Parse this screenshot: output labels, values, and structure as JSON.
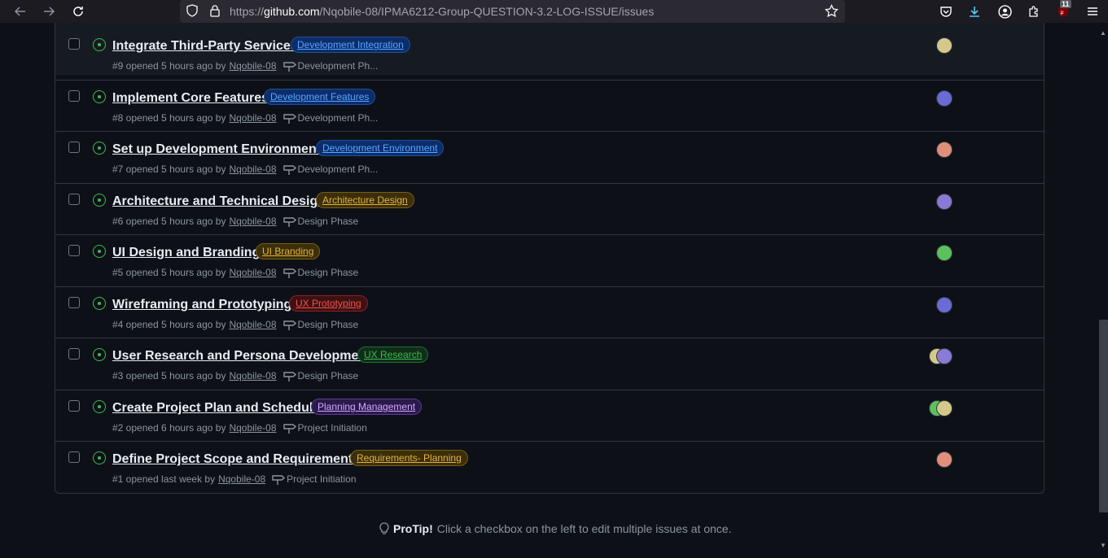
{
  "browser": {
    "url_prefix": "https://",
    "url_host": "github.com",
    "url_path": "/Nqobile-08/IPMA6212-Group-QUESTION-3.2-LOG-ISSUE/issues",
    "extension_badge": "11"
  },
  "issues": [
    {
      "title": "Integrate Third-Party Services",
      "label": "Development Integration",
      "label_color": "#58a6ff",
      "label_bg": "#0c2d6b",
      "meta": "#9 opened 5 hours ago by",
      "author": "Nqobile-08",
      "milestone": "Development Ph...",
      "avatar_colors": [
        "#d4c98a"
      ]
    },
    {
      "title": "Implement Core Features",
      "label": "Development Features",
      "label_color": "#58a6ff",
      "label_bg": "#0c2d6b",
      "meta": "#8 opened 5 hours ago by",
      "author": "Nqobile-08",
      "milestone": "Development Ph...",
      "avatar_colors": [
        "#6a6bd6"
      ]
    },
    {
      "title": "Set up Development Environment",
      "label": "Development Environment",
      "label_color": "#58a6ff",
      "label_bg": "#0c2d6b",
      "meta": "#7 opened 5 hours ago by",
      "author": "Nqobile-08",
      "milestone": "Development Ph...",
      "avatar_colors": [
        "#e0907a"
      ]
    },
    {
      "title": "Architecture and Technical Design",
      "label": "Architecture Design",
      "label_color": "#e3b341",
      "label_bg": "#3b2e0a",
      "meta": "#6 opened 5 hours ago by",
      "author": "Nqobile-08",
      "milestone": "Design Phase",
      "avatar_colors": [
        "#8a7ad6"
      ]
    },
    {
      "title": "UI Design and Branding",
      "label": "UI Branding",
      "label_color": "#e3b341",
      "label_bg": "#3b2e0a",
      "meta": "#5 opened 5 hours ago by",
      "author": "Nqobile-08",
      "milestone": "Design Phase",
      "avatar_colors": [
        "#5cc15c"
      ]
    },
    {
      "title": "Wireframing and Prototyping",
      "label": "UX Prototyping",
      "label_color": "#f85149",
      "label_bg": "#3d1114",
      "meta": "#4 opened 5 hours ago by",
      "author": "Nqobile-08",
      "milestone": "Design Phase",
      "avatar_colors": [
        "#6a6bd6"
      ]
    },
    {
      "title": "User Research and Persona Development",
      "label": "UX Research",
      "label_color": "#3fb950",
      "label_bg": "#0f2e18",
      "meta": "#3 opened 5 hours ago by",
      "author": "Nqobile-08",
      "milestone": "Design Phase",
      "avatar_colors": [
        "#d4c98a",
        "#8a7ad6"
      ]
    },
    {
      "title": "Create Project Plan and Schedule",
      "label": "Planning Management",
      "label_color": "#d2a8ff",
      "label_bg": "#2a1a4a",
      "meta": "#2 opened 6 hours ago by",
      "author": "Nqobile-08",
      "milestone": "Project Initiation",
      "avatar_colors": [
        "#5cc15c",
        "#d4c98a"
      ]
    },
    {
      "title": "Define Project Scope and Requirements",
      "label": "Requirements- Planning",
      "label_color": "#e3b341",
      "label_bg": "#3b2e0a",
      "meta": "#1 opened last week by",
      "author": "Nqobile-08",
      "milestone": "Project Initiation",
      "avatar_colors": [
        "#e0907a"
      ]
    }
  ],
  "protip": {
    "heading": "ProTip!",
    "text": "Click a checkbox on the left to edit multiple issues at once."
  }
}
